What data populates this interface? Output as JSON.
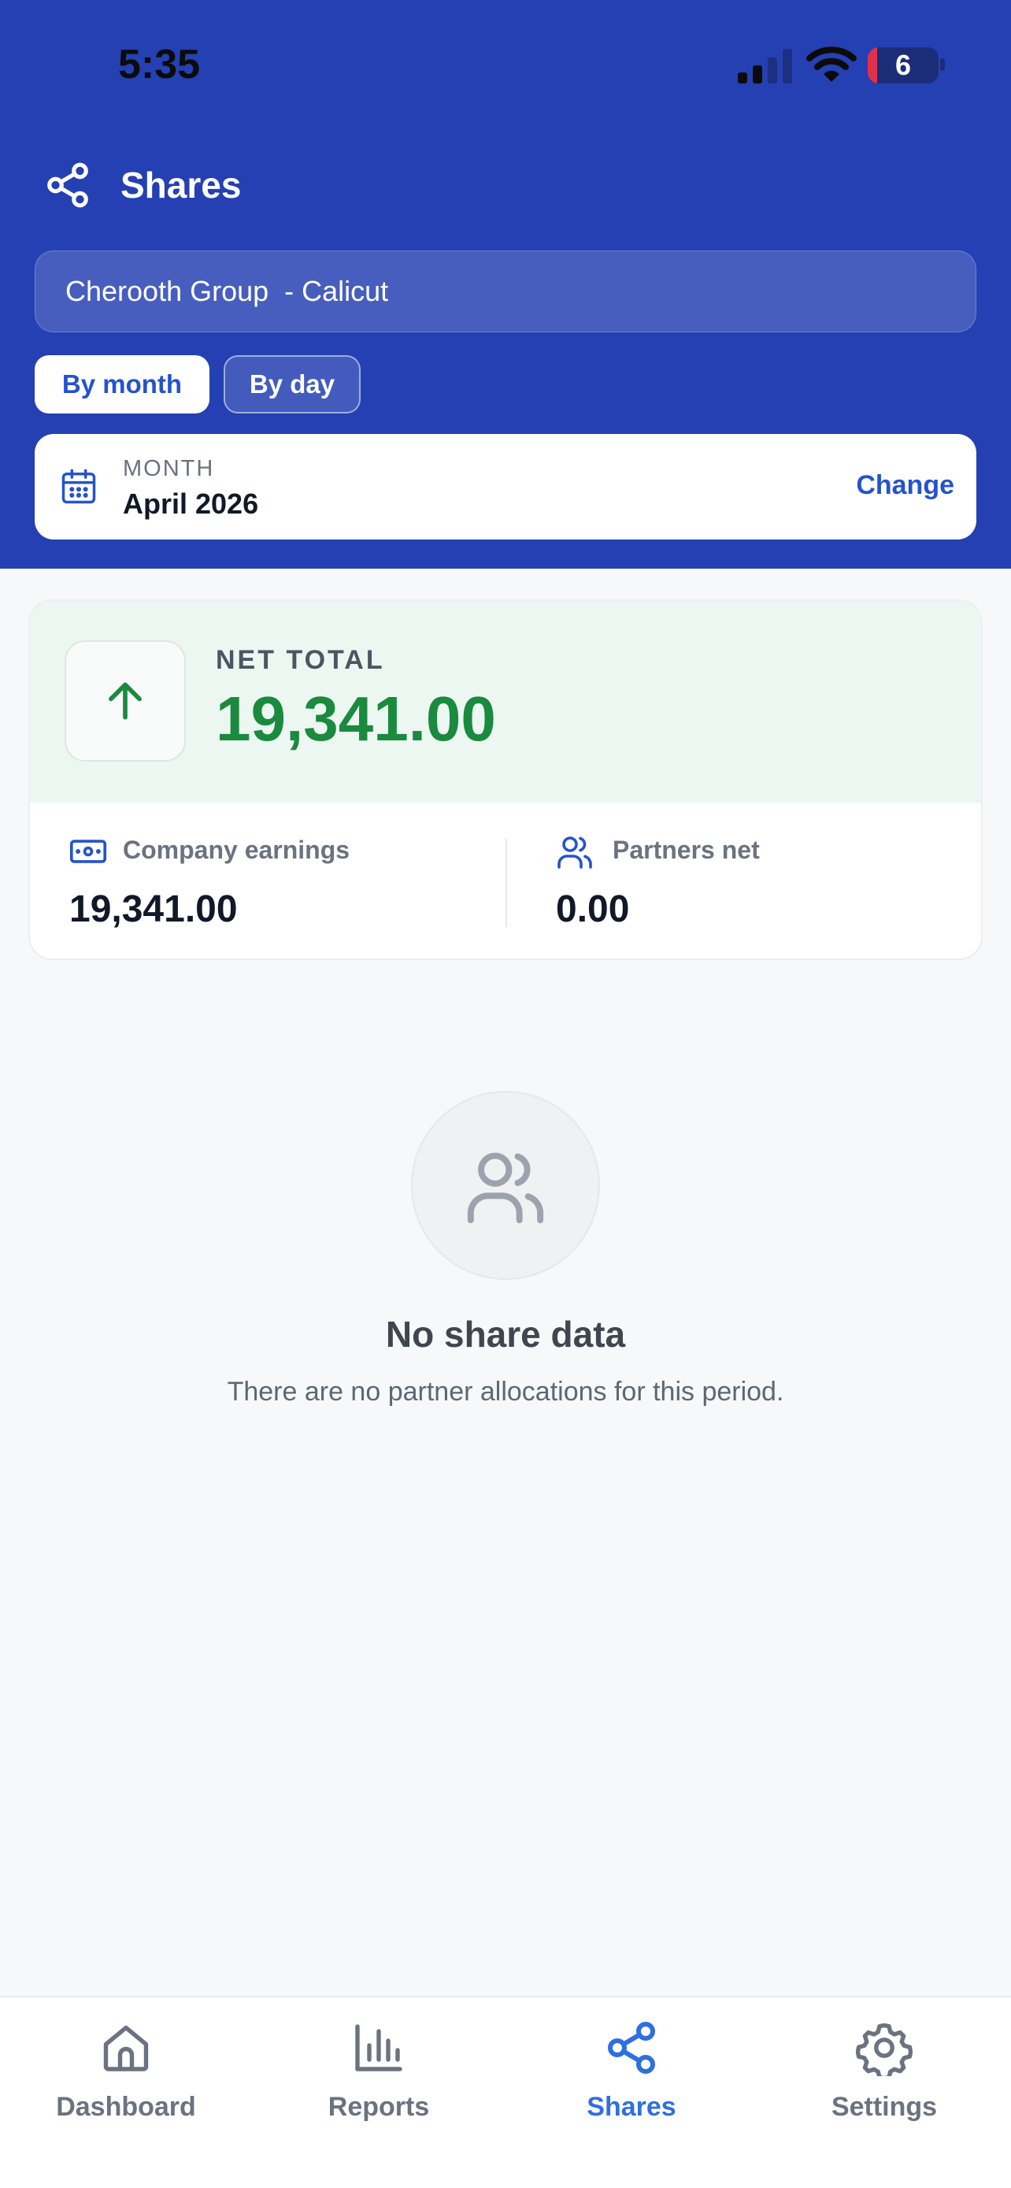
{
  "status_bar": {
    "time": "5:35",
    "battery": "6"
  },
  "header": {
    "title": "Shares"
  },
  "branch_select": {
    "value": "Cherooth Group  - Calicut"
  },
  "view_toggle": {
    "by_month": "By month",
    "by_day": "By day",
    "selected": "By month"
  },
  "month_picker": {
    "label": "MONTH",
    "value": "April 2026",
    "change": "Change"
  },
  "summary": {
    "net_label": "NET TOTAL",
    "net_value": "19,341.00",
    "company_label": "Company earnings",
    "company_value": "19,341.00",
    "partners_label": "Partners net",
    "partners_value": "0.00"
  },
  "empty_state": {
    "title": "No share data",
    "message": "There are no partner allocations for this period."
  },
  "tabs": [
    {
      "label": "Dashboard",
      "icon": "home-icon"
    },
    {
      "label": "Reports",
      "icon": "bar-chart-icon"
    },
    {
      "label": "Shares",
      "icon": "share-icon",
      "active": true
    },
    {
      "label": "Settings",
      "icon": "gear-icon"
    }
  ],
  "colors": {
    "header": "#2440b3",
    "accent": "#2553cc",
    "positive": "#1a8a3f",
    "active_tab": "#2f6fe0"
  }
}
